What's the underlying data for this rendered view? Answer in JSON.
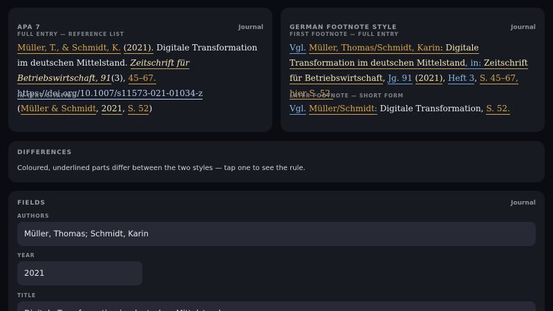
{
  "apa": {
    "title": "APA 7",
    "type": "Journal",
    "full_label": "FULL ENTRY — REFERENCE LIST",
    "full": {
      "authors": "Müller, T., & Schmidt, K.",
      "sp1": " ",
      "year": "(2021).",
      "title": " Digitale Transformation im deutschen Mittelstand. ",
      "journal": "Zeitschrift für Betriebswirtschaft, 91",
      "issue": "(3), ",
      "pages": "45–67.",
      "sp2": " ",
      "doi": "https://doi.org/10.1007/s11573-021-01034-z"
    },
    "intext_label": "IN-TEXT CITATION",
    "intext": {
      "open": "(",
      "authors": "Müller & Schmidt",
      "c1": ", ",
      "year": "2021",
      "c2": ", ",
      "page": "S. 52",
      "close": ")"
    }
  },
  "german": {
    "title": "GERMAN FOOTNOTE STYLE",
    "type": "Journal",
    "first_label": "FIRST FOOTNOTE — FULL ENTRY",
    "first": {
      "vgl": "Vgl.",
      "sp1": " ",
      "authors": "Müller, Thomas/Schmidt, Karin",
      "colon": ": ",
      "title": "Digitale Transformation im deutschen Mittelstand",
      "in": ", in: ",
      "journal": "Zeitschrift für Betriebswirtschaft",
      "c1": ", ",
      "jg": "Jg. 91",
      "sp2": " ",
      "year": "(2021)",
      "c2": ", ",
      "heft": "Heft 3",
      "c3": ", ",
      "pages": "S. 45–67, hier S. 52.",
      "end": ""
    },
    "later_label": "LATER FOOTNOTE — SHORT FORM",
    "later": {
      "vgl": "Vgl.",
      "sp1": " ",
      "authors": "Müller/Schmidt",
      "colon": ":",
      "title": " Digitale Transformation, ",
      "page": "S. 52."
    }
  },
  "differences": {
    "title": "DIFFERENCES",
    "text": "Coloured, underlined parts differ between the two styles — tap one to see the rule."
  },
  "fields": {
    "title": "FIELDS",
    "type": "Journal",
    "authors_label": "AUTHORS",
    "authors_value": "Müller, Thomas; Schmidt, Karin",
    "year_label": "YEAR",
    "year_value": "2021",
    "title_label": "TITLE",
    "title_value": "Digitale Transformation im deutschen Mittelstand"
  }
}
